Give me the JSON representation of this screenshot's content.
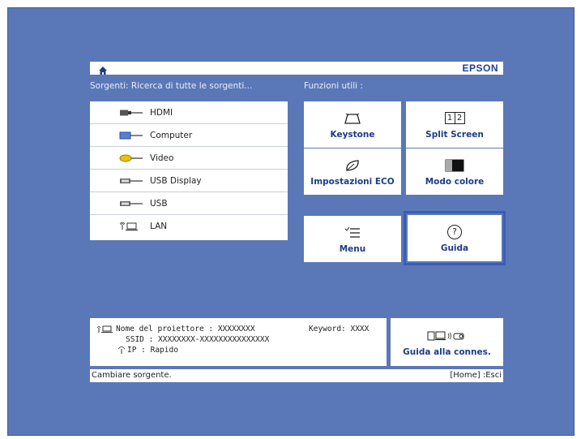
{
  "header": {
    "brand": "EPSON"
  },
  "sources_header": "Sorgenti: Ricerca di tutte le sorgenti...",
  "functions_header": "Funzioni utili :",
  "sources": [
    {
      "label": "HDMI",
      "icon": "hdmi-port-icon"
    },
    {
      "label": "Computer",
      "icon": "computer-port-icon"
    },
    {
      "label": "Video",
      "icon": "video-port-icon"
    },
    {
      "label": "USB Display",
      "icon": "usb-display-port-icon"
    },
    {
      "label": "USB",
      "icon": "usb-port-icon"
    },
    {
      "label": "LAN",
      "icon": "lan-icon"
    }
  ],
  "functions": {
    "keystone": "Keystone",
    "split_screen": "Split Screen",
    "split_glyph_1": "1",
    "split_glyph_2": "2",
    "eco": "Impostazioni ECO",
    "color_mode": "Modo colore",
    "menu": "Menu",
    "help": "Guida",
    "help_glyph": "?",
    "selected": "help"
  },
  "info": {
    "line1": "Nome del proiettore : XXXXXXXX",
    "keyword": "Keyword: XXXX",
    "line2": "SSID : XXXXXXXX-XXXXXXXXXXXXXXX",
    "line3": "IP : Rapido"
  },
  "connection_guide": "Guida alla connes.",
  "status": {
    "left": "Cambiare sorgente.",
    "right": "[Home] :Esci"
  },
  "colors": {
    "background": "#5a78b8",
    "accent": "#1d3c86",
    "selection": "#3b5db5"
  }
}
